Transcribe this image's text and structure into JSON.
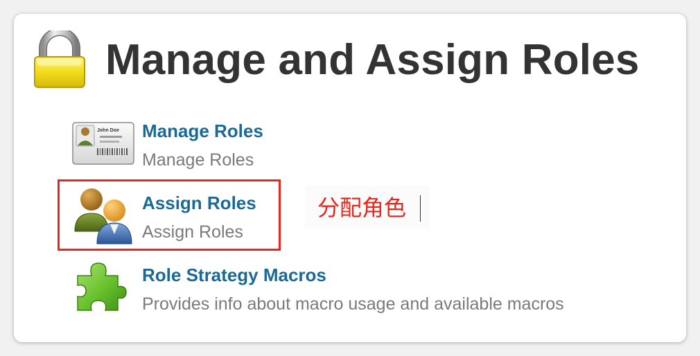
{
  "header": {
    "title": "Manage and Assign Roles",
    "icon": "padlock-icon"
  },
  "items": [
    {
      "link_label": "Manage Roles",
      "description": "Manage Roles",
      "icon": "id-card-icon",
      "card_name": "John Doe"
    },
    {
      "link_label": "Assign Roles",
      "description": "Assign Roles",
      "icon": "users-icon",
      "highlighted": true
    },
    {
      "link_label": "Role Strategy Macros",
      "description": "Provides info about macro usage and available macros",
      "icon": "puzzle-piece-icon"
    }
  ],
  "annotation": {
    "text": "分配角色",
    "color": "#e8261c"
  },
  "colors": {
    "link": "#1a6a98",
    "title": "#333333",
    "description": "#7a7a7a",
    "highlight": "#e8261c"
  }
}
